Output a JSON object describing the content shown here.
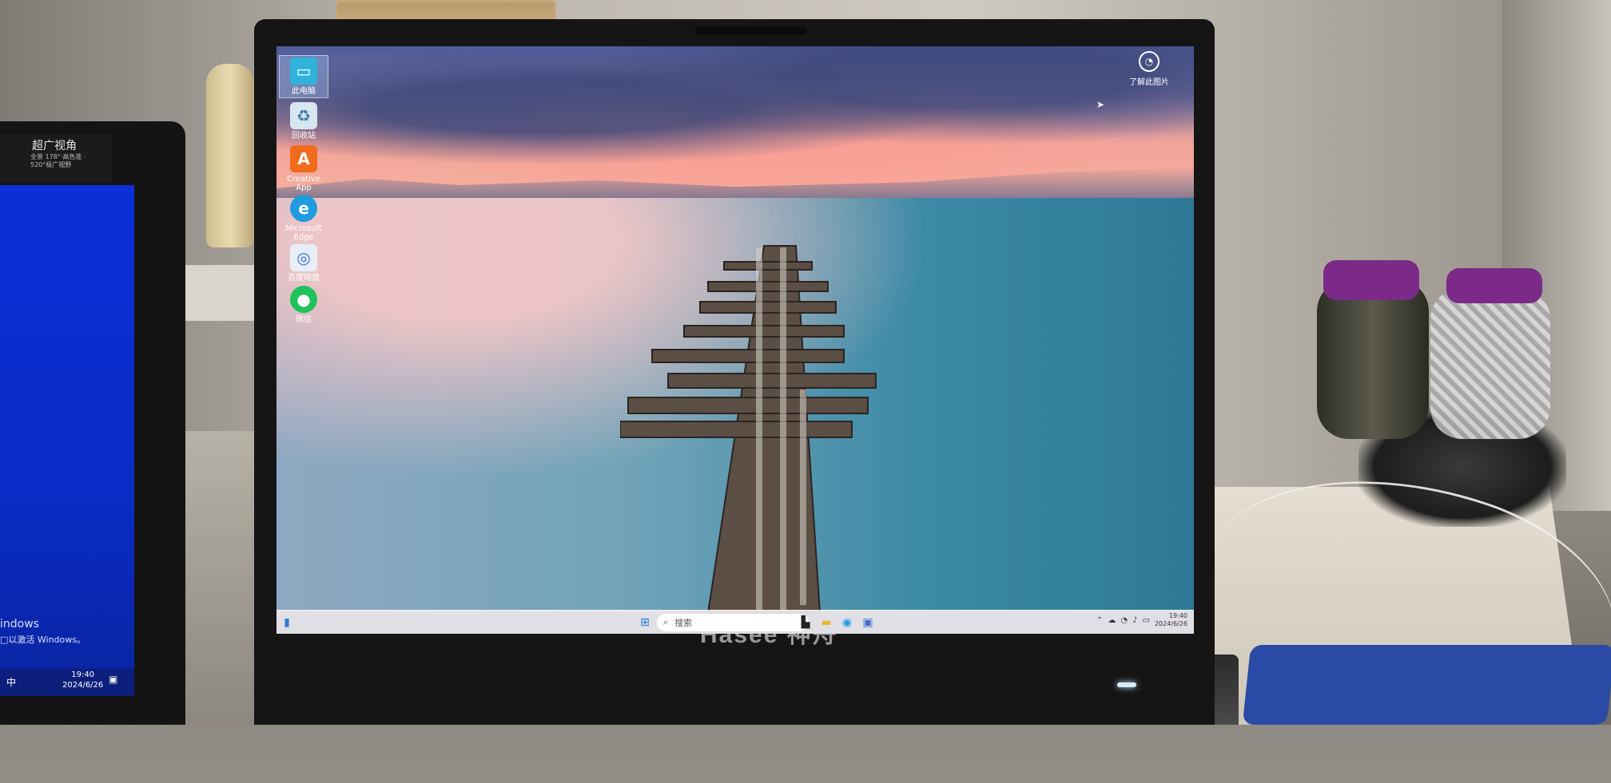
{
  "laptop": {
    "brand": "Hasee 神舟"
  },
  "desktop": {
    "icons": [
      {
        "label": "此电脑",
        "icon": "computer-icon",
        "color": "#2fb3d9"
      },
      {
        "label": "回收站",
        "icon": "recycle-bin-icon",
        "color": "#d7e6ef"
      },
      {
        "label": "Creative App",
        "icon": "creative-app-icon",
        "color": "#f06b1c"
      },
      {
        "label": "Microsoft Edge",
        "icon": "edge-icon",
        "color": "#1f9be0"
      },
      {
        "label": "百度网盘",
        "icon": "baidu-netdisk-icon",
        "color": "#e8eef8"
      },
      {
        "label": "微信",
        "icon": "wechat-icon",
        "color": "#21c25c"
      }
    ],
    "learn_image": "了解此图片"
  },
  "taskbar": {
    "search_placeholder": "搜索",
    "time": "19:40",
    "date": "2024/6/26"
  },
  "monitor2": {
    "header_title": "超广视角",
    "header_sub": "全景 178°·高色准 · 520°极广视野",
    "watermark_line1": "indows",
    "watermark_line2": "□以激活 Windows。",
    "ime": "中",
    "time": "19:40",
    "date": "2024/6/26"
  }
}
